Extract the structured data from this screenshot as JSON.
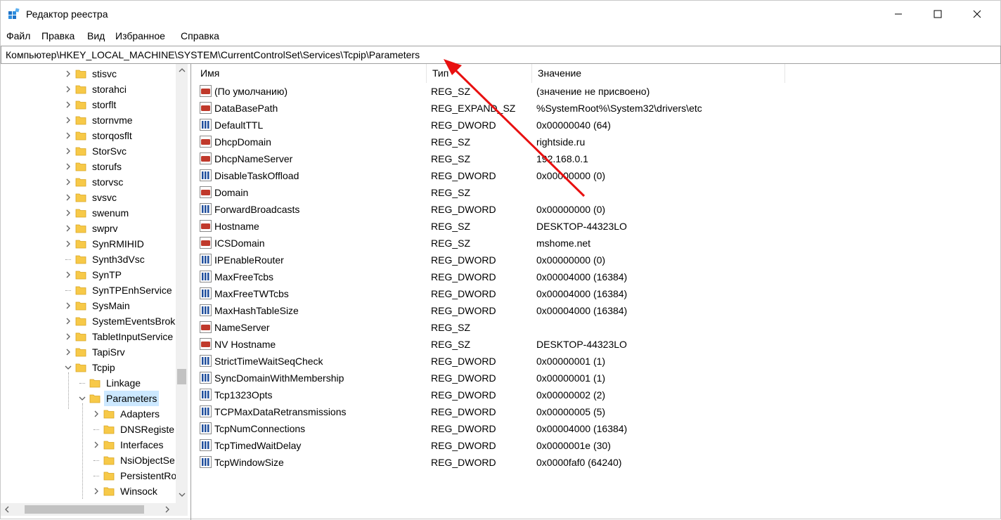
{
  "window": {
    "title": "Редактор реестра",
    "icon": "registry-editor-icon"
  },
  "menu": [
    {
      "label": "Файл"
    },
    {
      "label": "Правка"
    },
    {
      "label": "Вид"
    },
    {
      "label": "Избранное"
    },
    {
      "label": "Справка"
    }
  ],
  "address": "Компьютер\\HKEY_LOCAL_MACHINE\\SYSTEM\\CurrentControlSet\\Services\\Tcpip\\Parameters",
  "tree": [
    {
      "label": "stisvc",
      "level": 0,
      "expander": "collapsed"
    },
    {
      "label": "storahci",
      "level": 0,
      "expander": "collapsed"
    },
    {
      "label": "storflt",
      "level": 0,
      "expander": "collapsed"
    },
    {
      "label": "stornvme",
      "level": 0,
      "expander": "collapsed"
    },
    {
      "label": "storqosflt",
      "level": 0,
      "expander": "collapsed"
    },
    {
      "label": "StorSvc",
      "level": 0,
      "expander": "collapsed"
    },
    {
      "label": "storufs",
      "level": 0,
      "expander": "collapsed"
    },
    {
      "label": "storvsc",
      "level": 0,
      "expander": "collapsed"
    },
    {
      "label": "svsvc",
      "level": 0,
      "expander": "collapsed"
    },
    {
      "label": "swenum",
      "level": 0,
      "expander": "collapsed"
    },
    {
      "label": "swprv",
      "level": 0,
      "expander": "collapsed"
    },
    {
      "label": "SynRMIHID",
      "level": 0,
      "expander": "collapsed"
    },
    {
      "label": "Synth3dVsc",
      "level": 0,
      "expander": "none"
    },
    {
      "label": "SynTP",
      "level": 0,
      "expander": "collapsed"
    },
    {
      "label": "SynTPEnhService",
      "level": 0,
      "expander": "none"
    },
    {
      "label": "SysMain",
      "level": 0,
      "expander": "collapsed"
    },
    {
      "label": "SystemEventsBrok",
      "level": 0,
      "expander": "collapsed"
    },
    {
      "label": "TabletInputService",
      "level": 0,
      "expander": "collapsed"
    },
    {
      "label": "TapiSrv",
      "level": 0,
      "expander": "collapsed"
    },
    {
      "label": "Tcpip",
      "level": 0,
      "expander": "expanded"
    },
    {
      "label": "Linkage",
      "level": 1,
      "expander": "none"
    },
    {
      "label": "Parameters",
      "level": 1,
      "expander": "expanded",
      "selected": true
    },
    {
      "label": "Adapters",
      "level": 2,
      "expander": "collapsed"
    },
    {
      "label": "DNSRegiste",
      "level": 2,
      "expander": "none"
    },
    {
      "label": "Interfaces",
      "level": 2,
      "expander": "collapsed"
    },
    {
      "label": "NsiObjectSe",
      "level": 2,
      "expander": "none"
    },
    {
      "label": "PersistentRo",
      "level": 2,
      "expander": "none"
    },
    {
      "label": "Winsock",
      "level": 2,
      "expander": "collapsed"
    }
  ],
  "columns": {
    "name": "Имя",
    "type": "Тип",
    "value": "Значение"
  },
  "values": [
    {
      "name": "(По умолчанию)",
      "type": "REG_SZ",
      "data": "(значение не присвоено)",
      "icon": "string-value-icon"
    },
    {
      "name": "DataBasePath",
      "type": "REG_EXPAND_SZ",
      "data": "%SystemRoot%\\System32\\drivers\\etc",
      "icon": "string-value-icon"
    },
    {
      "name": "DefaultTTL",
      "type": "REG_DWORD",
      "data": "0x00000040 (64)",
      "icon": "binary-value-icon"
    },
    {
      "name": "DhcpDomain",
      "type": "REG_SZ",
      "data": "rightside.ru",
      "icon": "string-value-icon"
    },
    {
      "name": "DhcpNameServer",
      "type": "REG_SZ",
      "data": "192.168.0.1",
      "icon": "string-value-icon"
    },
    {
      "name": "DisableTaskOffload",
      "type": "REG_DWORD",
      "data": "0x00000000 (0)",
      "icon": "binary-value-icon"
    },
    {
      "name": "Domain",
      "type": "REG_SZ",
      "data": "",
      "icon": "string-value-icon"
    },
    {
      "name": "ForwardBroadcasts",
      "type": "REG_DWORD",
      "data": "0x00000000 (0)",
      "icon": "binary-value-icon"
    },
    {
      "name": "Hostname",
      "type": "REG_SZ",
      "data": "DESKTOP-44323LO",
      "icon": "string-value-icon"
    },
    {
      "name": "ICSDomain",
      "type": "REG_SZ",
      "data": "mshome.net",
      "icon": "string-value-icon"
    },
    {
      "name": "IPEnableRouter",
      "type": "REG_DWORD",
      "data": "0x00000000 (0)",
      "icon": "binary-value-icon"
    },
    {
      "name": "MaxFreeTcbs",
      "type": "REG_DWORD",
      "data": "0x00004000 (16384)",
      "icon": "binary-value-icon"
    },
    {
      "name": "MaxFreeTWTcbs",
      "type": "REG_DWORD",
      "data": "0x00004000 (16384)",
      "icon": "binary-value-icon"
    },
    {
      "name": "MaxHashTableSize",
      "type": "REG_DWORD",
      "data": "0x00004000 (16384)",
      "icon": "binary-value-icon"
    },
    {
      "name": "NameServer",
      "type": "REG_SZ",
      "data": "",
      "icon": "string-value-icon"
    },
    {
      "name": "NV Hostname",
      "type": "REG_SZ",
      "data": "DESKTOP-44323LO",
      "icon": "string-value-icon"
    },
    {
      "name": "StrictTimeWaitSeqCheck",
      "type": "REG_DWORD",
      "data": "0x00000001 (1)",
      "icon": "binary-value-icon"
    },
    {
      "name": "SyncDomainWithMembership",
      "type": "REG_DWORD",
      "data": "0x00000001 (1)",
      "icon": "binary-value-icon"
    },
    {
      "name": "Tcp1323Opts",
      "type": "REG_DWORD",
      "data": "0x00000002 (2)",
      "icon": "binary-value-icon"
    },
    {
      "name": "TCPMaxDataRetransmissions",
      "type": "REG_DWORD",
      "data": "0x00000005 (5)",
      "icon": "binary-value-icon"
    },
    {
      "name": "TcpNumConnections",
      "type": "REG_DWORD",
      "data": "0x00004000 (16384)",
      "icon": "binary-value-icon"
    },
    {
      "name": "TcpTimedWaitDelay",
      "type": "REG_DWORD",
      "data": "0x0000001e (30)",
      "icon": "binary-value-icon"
    },
    {
      "name": "TcpWindowSize",
      "type": "REG_DWORD",
      "data": "0x0000faf0 (64240)",
      "icon": "binary-value-icon"
    }
  ],
  "colors": {
    "selection": "#cce8ff",
    "annotation_arrow": "#e81010",
    "folder": "#f7c948",
    "string_icon": "#c0392b",
    "binary_icon": "#1f4e9c"
  }
}
